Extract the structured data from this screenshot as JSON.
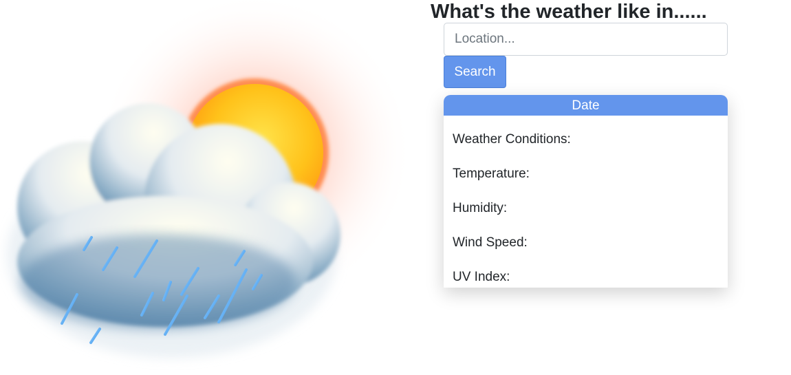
{
  "illustration": {
    "icon": "cloud-sun-rain-icon",
    "colors": {
      "sun": "#ffc21a",
      "sun_glow": "#ff6a3d",
      "cloud": "#e9eef2",
      "cloud_shadow": "#4f7ea6",
      "rain": "#3a9df0"
    }
  },
  "header": {
    "title": "What's the weather like in......"
  },
  "search": {
    "placeholder": "Location...",
    "value": "",
    "button_label": "Search"
  },
  "card": {
    "header_label": "Date",
    "rows": [
      {
        "label": "Weather Conditions:"
      },
      {
        "label": "Temperature:"
      },
      {
        "label": "Humidity:"
      },
      {
        "label": "Wind Speed:"
      },
      {
        "label": "UV Index:"
      }
    ]
  },
  "colors": {
    "accent": "#6395ec",
    "text": "#212529"
  }
}
